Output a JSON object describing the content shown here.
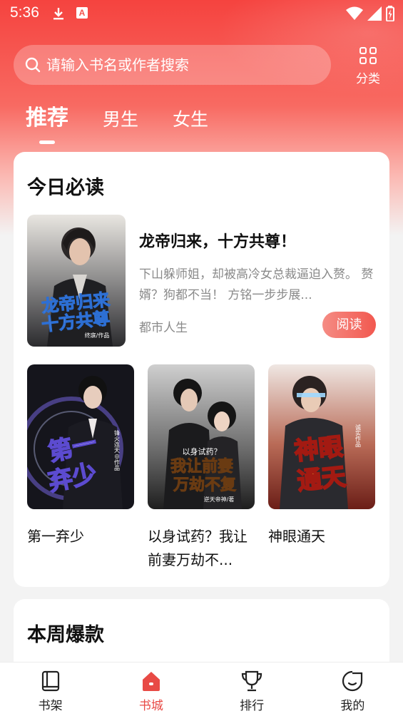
{
  "status_bar": {
    "time": "5:36",
    "badge_letter": "A"
  },
  "search": {
    "placeholder": "请输入书名或作者搜索"
  },
  "category": {
    "label": "分类"
  },
  "tabs": [
    {
      "label": "推荐",
      "active": true
    },
    {
      "label": "男生",
      "active": false
    },
    {
      "label": "女生",
      "active": false
    }
  ],
  "today": {
    "title": "今日必读",
    "featured": {
      "title": "龙帝归来，十方共尊！",
      "description": "下山躲师姐，却被高冷女总裁逼迫入赘。 赘婿？狗都不当！ 方铭一步步展...",
      "tag": "都市人生",
      "read_label": "阅读",
      "cover_text": "龙帝归来十方共尊",
      "cover_sub": "终寐/作品"
    },
    "books": [
      {
        "name": "第一弃少",
        "cover_text": "第一弃少",
        "cover_sub": "锋火连天◎作品"
      },
      {
        "name": "以身试药？我让前妻万劫不...",
        "cover_text": "我让前妻万劫不复",
        "cover_top": "以身试药？",
        "cover_sub": "逆天帝神/著"
      },
      {
        "name": "神眼通天",
        "cover_text": "神眼通天",
        "cover_sub": "诚实作品"
      }
    ]
  },
  "week": {
    "title": "本周爆款"
  },
  "bottom_nav": [
    {
      "label": "书架",
      "icon": "bookshelf-icon",
      "active": false
    },
    {
      "label": "书城",
      "icon": "home-icon",
      "active": true
    },
    {
      "label": "排行",
      "icon": "trophy-icon",
      "active": false
    },
    {
      "label": "我的",
      "icon": "profile-icon",
      "active": false
    }
  ],
  "colors": {
    "accent": "#e84a45",
    "header_top": "#f5433f",
    "muted_text": "#8a8a8a"
  }
}
